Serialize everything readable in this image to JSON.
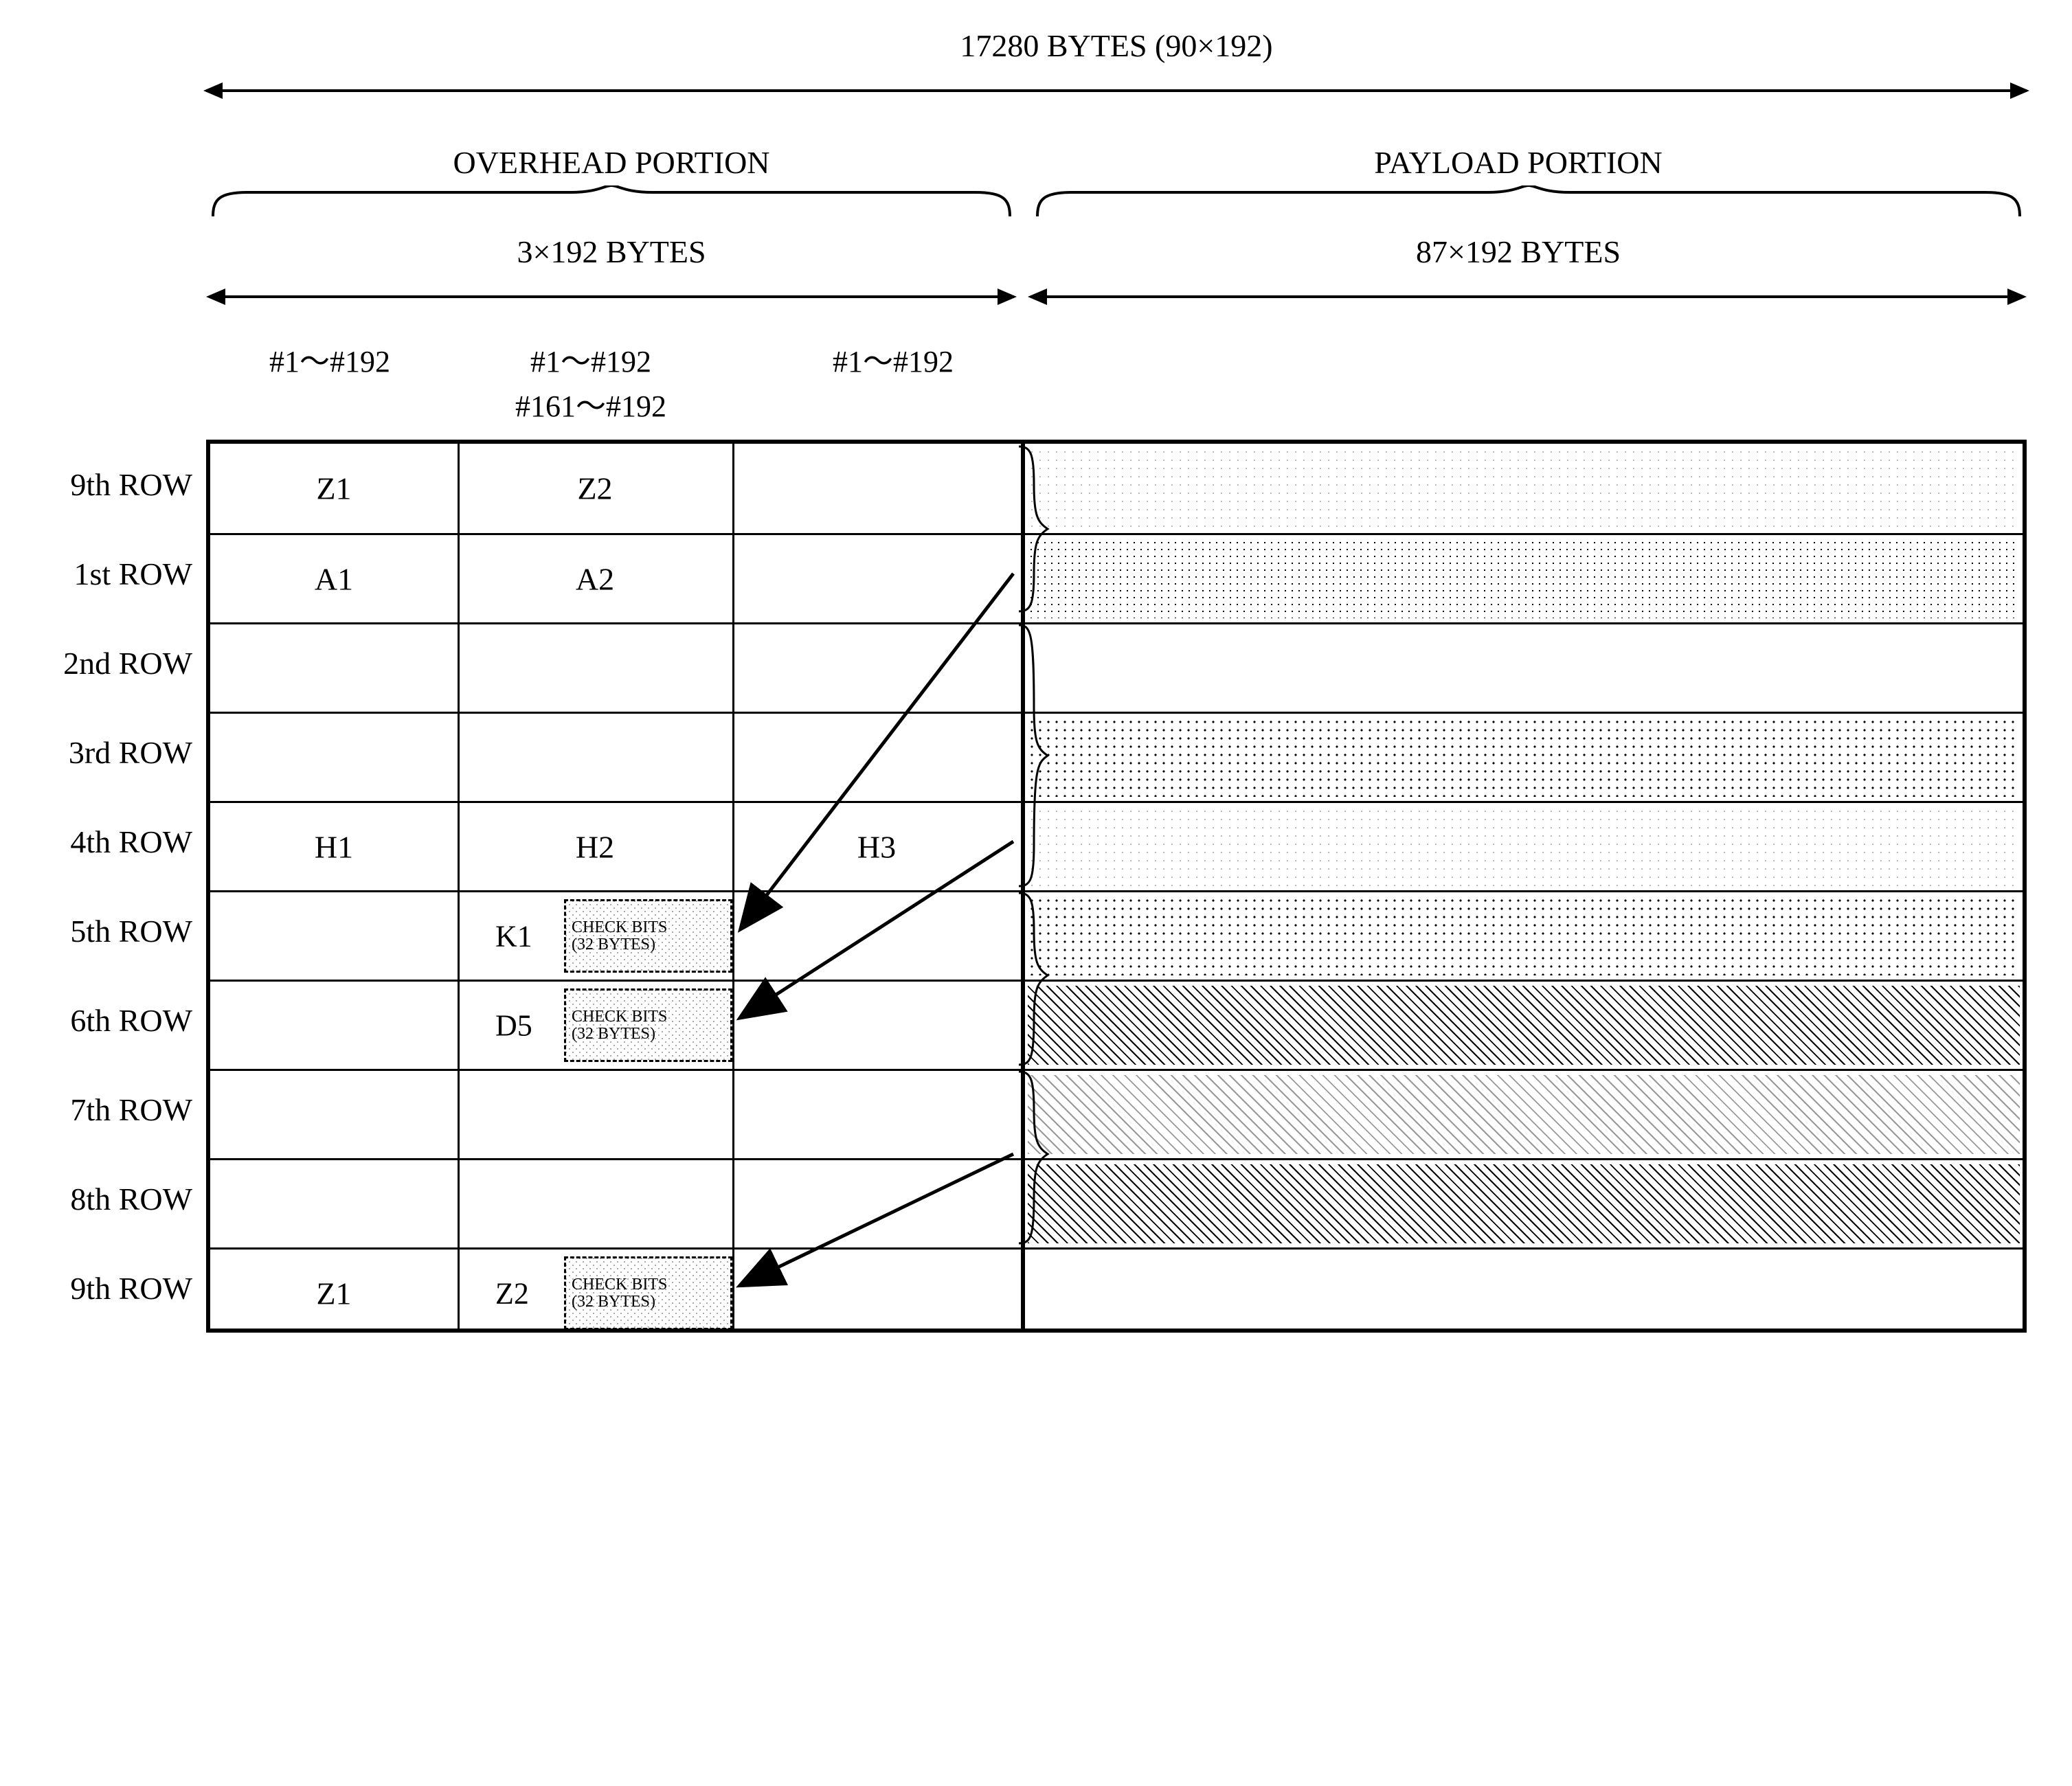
{
  "top_label": "17280 BYTES (90×192)",
  "sections": {
    "overhead": {
      "title": "OVERHEAD PORTION",
      "bytes": "3×192 BYTES"
    },
    "payload": {
      "title": "PAYLOAD PORTION",
      "bytes": "87×192 BYTES"
    }
  },
  "col_headers": {
    "c1": "#1～#192",
    "c2_top": "#1～#192",
    "c2_bot": "#161～#192",
    "c3": "#1～#192"
  },
  "check_bits_label": "CHECK BITS\n(32 BYTES)",
  "rows": [
    {
      "label": "9th ROW",
      "c1": "Z1",
      "c2": "Z2",
      "c3": "",
      "check": false,
      "fill": "fill-dots-lt"
    },
    {
      "label": "1st ROW",
      "c1": "A1",
      "c2": "A2",
      "c3": "",
      "check": false,
      "fill": "fill-dots-fine"
    },
    {
      "label": "2nd ROW",
      "c1": "",
      "c2": "",
      "c3": "",
      "check": false,
      "fill": ""
    },
    {
      "label": "3rd ROW",
      "c1": "",
      "c2": "",
      "c3": "",
      "check": false,
      "fill": "fill-dots-med"
    },
    {
      "label": "4th ROW",
      "c1": "H1",
      "c2": "H2",
      "c3": "H3",
      "check": false,
      "fill": "fill-dots-lt"
    },
    {
      "label": "5th ROW",
      "c1": "",
      "c2": "K1",
      "c3": "",
      "check": true,
      "fill": "fill-dots-med"
    },
    {
      "label": "6th ROW",
      "c1": "",
      "c2": "D5",
      "c3": "",
      "check": true,
      "fill": "fill-hatch"
    },
    {
      "label": "7th ROW",
      "c1": "",
      "c2": "",
      "c3": "",
      "check": false,
      "fill": "fill-hatch-lt"
    },
    {
      "label": "8th ROW",
      "c1": "",
      "c2": "",
      "c3": "",
      "check": false,
      "fill": "fill-hatch"
    },
    {
      "label": "9th ROW",
      "c1": "Z1",
      "c2": "Z2",
      "c3": "",
      "check": true,
      "fill": ""
    }
  ]
}
